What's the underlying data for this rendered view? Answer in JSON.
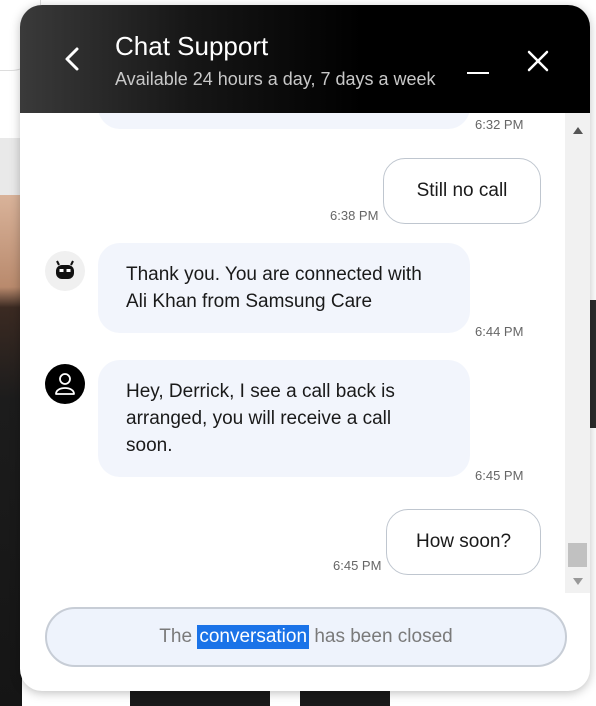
{
  "header": {
    "title": "Chat Support",
    "subtitle": "Available 24 hours a day, 7 days a week"
  },
  "messages": [
    {
      "from": "agent",
      "text": "",
      "time": "6:32 PM"
    },
    {
      "from": "user",
      "text": "Still no call",
      "time": "6:38 PM"
    },
    {
      "from": "bot",
      "text": "Thank you. You are connected with Ali Khan from Samsung Care",
      "time": "6:44 PM"
    },
    {
      "from": "agent",
      "text": "Hey, Derrick, I see a call back is arranged, you will receive a call soon.",
      "time": "6:45 PM"
    },
    {
      "from": "user",
      "text": "How soon?",
      "time": "6:45 PM"
    }
  ],
  "footer": {
    "status_before": "The ",
    "status_highlight": "conversation",
    "status_after": " has been closed"
  },
  "icons": {
    "back": "chevron-left-icon",
    "minimize": "minimize-icon",
    "close": "close-icon",
    "bot": "robot-avatar-icon",
    "agent": "person-avatar-icon"
  },
  "colors": {
    "header_bg": "#000000",
    "bubble_in": "#f2f5fc",
    "selection": "#1a73e8"
  }
}
